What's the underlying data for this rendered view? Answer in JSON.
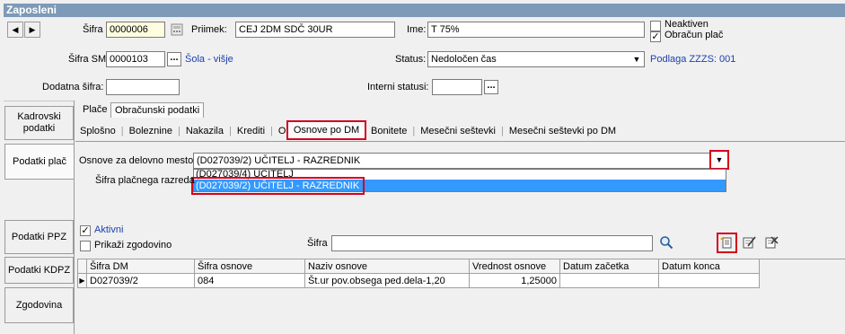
{
  "window": {
    "title": "Zaposleni"
  },
  "header": {
    "nav_prev": "◀",
    "nav_next": "▶",
    "sifra_label": "Šifra",
    "sifra_value": "0000006",
    "priimek_label": "Priimek:",
    "priimek_value": "CEJ 2DM SDČ 30UR",
    "ime_label": "Ime:",
    "ime_value": "T 75%",
    "neaktiven_label": "Neaktiven",
    "obracun_label": "Obračun plač",
    "sifra_sm_label": "Šifra SM",
    "sifra_sm_value": "0000103",
    "sifra_sm_btn": "...",
    "sifra_sm_name": "Šola - višje",
    "status_label": "Status:",
    "status_value": "Nedoločen čas",
    "podlaga": "Podlaga ZZZS: 001",
    "dodatna_label": "Dodatna šifra:",
    "dodatna_value": "",
    "interni_label": "Interni statusi:",
    "interni_value": "",
    "interni_btn": "..."
  },
  "sidebar": {
    "items": [
      {
        "label": "Kadrovski podatki"
      },
      {
        "label": "Podatki plač"
      },
      {
        "label": "Podatki PPZ"
      },
      {
        "label": "Podatki KDPZ"
      },
      {
        "label": "Zgodovina"
      }
    ]
  },
  "tabs_main": [
    {
      "label": "Plače"
    },
    {
      "label": "Obračunski podatki"
    }
  ],
  "tabs_sub": [
    {
      "label": "Splošno"
    },
    {
      "label": "Boleznine"
    },
    {
      "label": "Nakazila"
    },
    {
      "label": "Krediti"
    },
    {
      "label": "Osnove"
    },
    {
      "label": "Osnove po DM"
    },
    {
      "label": "Bonitete"
    },
    {
      "label": "Mesečni seštevki"
    },
    {
      "label": "Mesečni seštevki po DM"
    }
  ],
  "osnove": {
    "label": "Osnove  za delovno mesto",
    "selected": "(D027039/2) UČITELJ - RAZREDNIK",
    "options": [
      "(D027039/4) UČITELJ",
      "(D027039/2) UČITELJ - RAZREDNIK"
    ],
    "razred_label": "Šifra plačnega razreda"
  },
  "filters": {
    "aktivni_label": "Aktivni",
    "zgodovino_label": "Prikaži zgodovino",
    "sifra_label": "Šifra",
    "sifra_value": ""
  },
  "grid": {
    "columns": [
      "Šifra DM",
      "Šifra osnove",
      "Naziv osnove",
      "Vrednost osnove",
      "Datum začetka",
      "Datum konca"
    ],
    "rows": [
      [
        "D027039/2",
        "084",
        "Št.ur pov.obsega ped.dela-1,20",
        "1,25000",
        "",
        ""
      ]
    ]
  },
  "colors": {
    "titlebar": "#7d9ab8",
    "highlight": "#3399ff",
    "red_frame": "#d4001c",
    "link": "#1a3fb0"
  }
}
